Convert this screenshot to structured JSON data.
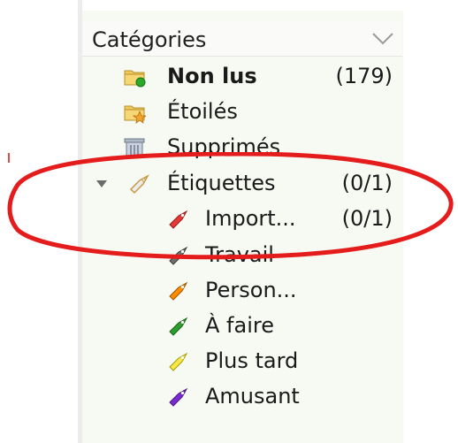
{
  "categories": {
    "title": "Catégories",
    "items": [
      {
        "label": "Non lus",
        "count": "(179)",
        "icon": "unread-folder-icon"
      },
      {
        "label": "Étoilés",
        "count": "",
        "icon": "starred-folder-icon"
      },
      {
        "label": "Supprimés",
        "count": "",
        "icon": "trash-icon"
      },
      {
        "label": "Étiquettes",
        "count": "(0/1)",
        "icon": "tag-icon"
      }
    ],
    "tags": [
      {
        "label": "Import...",
        "count": "(0/1)",
        "color": "#e53935"
      },
      {
        "label": "Travail",
        "count": "",
        "color": "#6f6f6f"
      },
      {
        "label": "Person...",
        "count": "",
        "color": "#fb8c00"
      },
      {
        "label": "À faire",
        "count": "",
        "color": "#2e9d2e"
      },
      {
        "label": "Plus tard",
        "count": "",
        "color": "#f6e84b"
      },
      {
        "label": "Amusant",
        "count": "",
        "color": "#7a2bd0"
      }
    ]
  },
  "colors": {
    "annotation": "#e51c1c",
    "panel_bg": "#f7faf2"
  }
}
